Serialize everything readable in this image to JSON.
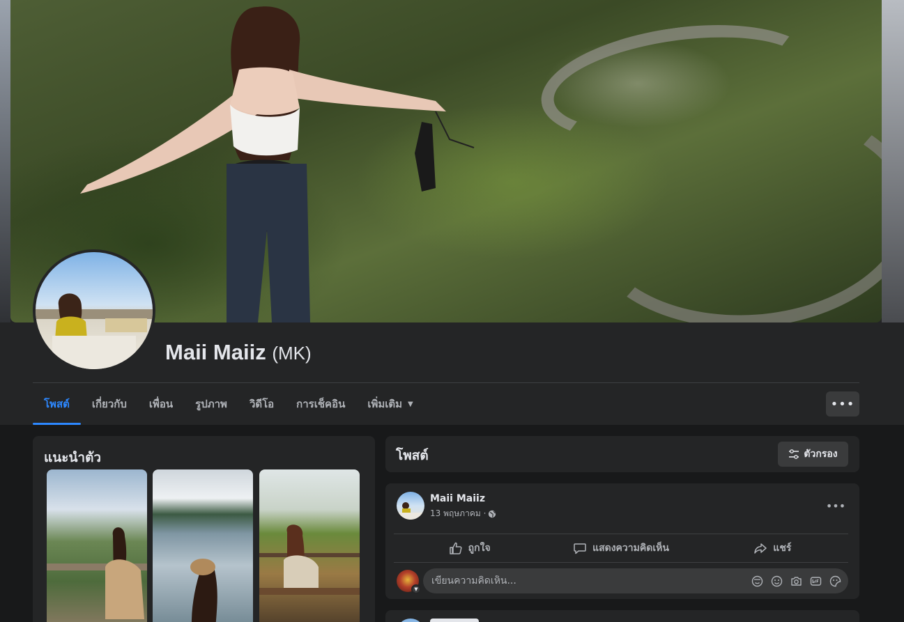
{
  "profile": {
    "name": "Maii Maiiz",
    "alt_name": "(MK)"
  },
  "tabs": [
    {
      "label": "โพสต์",
      "active": true
    },
    {
      "label": "เกี่ยวกับ"
    },
    {
      "label": "เพื่อน"
    },
    {
      "label": "รูปภาพ"
    },
    {
      "label": "วิดีโอ"
    },
    {
      "label": "การเช็คอิน"
    },
    {
      "label": "เพิ่มเติม"
    }
  ],
  "intro": {
    "title": "แนะนำตัว"
  },
  "posts": {
    "title": "โพสต์",
    "filter_label": "ตัวกรอง"
  },
  "post": {
    "author": "Maii Maiiz",
    "date": "13 พฤษภาคม ·",
    "privacy_icon": "globe-icon",
    "like_label": "ถูกใจ",
    "comment_label": "แสดงความคิดเห็น",
    "share_label": "แชร์",
    "comment_placeholder": "เขียนความคิดเห็น..."
  },
  "colors": {
    "accent": "#2d88ff",
    "background": "#18191a",
    "card": "#242526",
    "button": "#3a3b3c",
    "text_primary": "#e4e6eb",
    "text_secondary": "#b0b3b8"
  }
}
